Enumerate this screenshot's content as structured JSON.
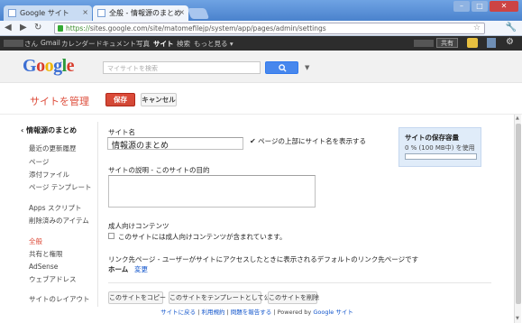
{
  "browser": {
    "tabs": [
      {
        "label": "Google サイト",
        "active": false
      },
      {
        "label": "全般 - 情報源のまとめ",
        "active": true
      }
    ],
    "url_scheme": "https://",
    "url_rest": "sites.google.com/site/matomefilejp/system/app/pages/admin/settings"
  },
  "gbar": {
    "items": [
      "さん",
      "Gmail",
      "カレンダー",
      "ドキュメント",
      "写真",
      "サイト",
      "検索",
      "もっと見る ▾"
    ],
    "selected": "サイト",
    "share_label": "共有"
  },
  "search": {
    "placeholder": "マイサイトを検索"
  },
  "header": {
    "title": "サイトを管理",
    "save_label": "保存",
    "cancel_label": "キャンセル"
  },
  "sidebar": {
    "back_label": "情報源のまとめ",
    "items": [
      {
        "label": "最近の更新履歴"
      },
      {
        "label": "ページ"
      },
      {
        "label": "添付ファイル"
      },
      {
        "label": "ページ テンプレート"
      },
      {
        "label": "Apps スクリプト"
      },
      {
        "label": "削除済みのアイテム"
      },
      {
        "label": "全般",
        "active": true
      },
      {
        "label": "共有と権限"
      },
      {
        "label": "AdSense"
      },
      {
        "label": "ウェブアドレス"
      },
      {
        "label": "サイトのレイアウト"
      }
    ]
  },
  "main": {
    "site_name_label": "サイト名",
    "site_name_value": "情報源のまとめ",
    "show_name_label": "ページの上部にサイト名を表示する",
    "description_label": "サイトの説明 - このサイトの目的",
    "adult_label": "成人向けコンテンツ",
    "adult_checkbox_label": "このサイトには成人向けコンテンツが含まれています。",
    "landing_label": "リンク先ページ - ユーザーがサイトにアクセスしたときに表示されるデフォルトのリンク先ページです",
    "landing_value": "ホーム",
    "change_link": "変更"
  },
  "storage": {
    "title": "サイトの保存容量",
    "usage": "0 % (100 MB中) を使用",
    "used_fraction": 0
  },
  "actions": {
    "copy_label": "このサイトをコピー",
    "template_label": "このサイトをテンプレートとして公開",
    "delete_label": "このサイトを削除"
  },
  "footer": {
    "report": "サイトに戻る",
    "terms": "利用規約",
    "abuse": "問題を報告する",
    "powered_prefix": "Powered by",
    "powered_link": "Google サイト"
  },
  "colors": {
    "accent_red": "#dd4b39",
    "link_blue": "#1155cc",
    "google_blue": "#4787ed"
  }
}
